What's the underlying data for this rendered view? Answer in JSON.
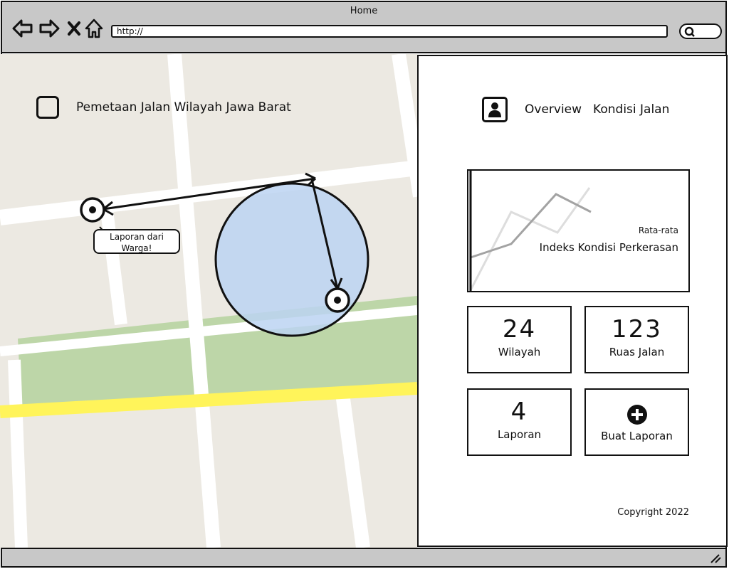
{
  "browser": {
    "tab_title": "Home",
    "url": "http://",
    "nav_icons": [
      "back-arrow-icon",
      "forward-arrow-icon",
      "close-x-icon",
      "home-icon"
    ],
    "search_icon": "search-icon"
  },
  "map": {
    "title": "Pemetaan Jalan Wilayah Jawa Barat",
    "callout": "Laporan dari Warga!",
    "colors": {
      "land": "#ece9e2",
      "road": "#ffffff",
      "park": "#bdd6a8",
      "highway": "#fff45a",
      "radius_fill": "#bcd4f2"
    }
  },
  "panel": {
    "header_left": "Overview",
    "header_right": "Kondisi Jalan",
    "chart_subtitle": "Rata-rata",
    "chart_title": "Indeks Kondisi Perkerasan",
    "stats": [
      {
        "value": "24",
        "label": "Wilayah"
      },
      {
        "value": "123",
        "label": "Ruas Jalan"
      },
      {
        "value": "4",
        "label": "Laporan"
      }
    ],
    "create_report": "Buat Laporan",
    "copyright": "Copyright 2022"
  }
}
